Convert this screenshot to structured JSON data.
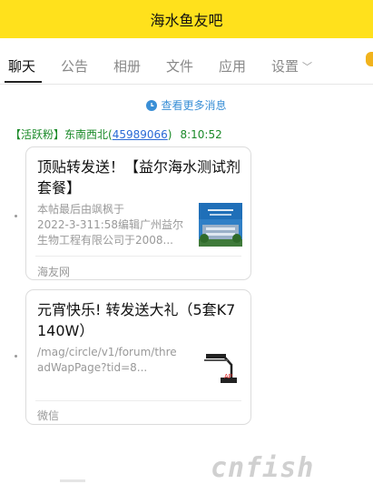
{
  "app": {
    "title": "海水鱼友吧"
  },
  "tabs": [
    {
      "label": "聊天",
      "active": true
    },
    {
      "label": "公告"
    },
    {
      "label": "相册"
    },
    {
      "label": "文件"
    },
    {
      "label": "应用"
    },
    {
      "label": "设置"
    }
  ],
  "messages_link": "查看更多消息",
  "sender": {
    "prefix": "【活跃粉】东南西北(",
    "qq": "45989066",
    "suffix": ")",
    "time": "8:10:52"
  },
  "cards": [
    {
      "title": "顶贴转发送！【益尔海水测试剂套餐】",
      "desc": [
        "本帖最后由飒枫于",
        "2022-3-311:58编辑广州益尔",
        "生物工程有限公司于2008..."
      ],
      "source": "海友网",
      "thumb_icon": "building-photo-icon"
    },
    {
      "title": "元宵快乐! 转发送大礼（5套K7 140W）",
      "desc": [
        "/mag/circle/v1/forum/thre",
        "adWapPage?tid=8..."
      ],
      "source": "微信",
      "thumb_icon": "lamp-product-icon"
    }
  ],
  "colors": {
    "title_bar": "#ffe11c",
    "link": "#3a8fd6",
    "sender": "#1a8a28"
  },
  "watermark_text": "cnfish"
}
